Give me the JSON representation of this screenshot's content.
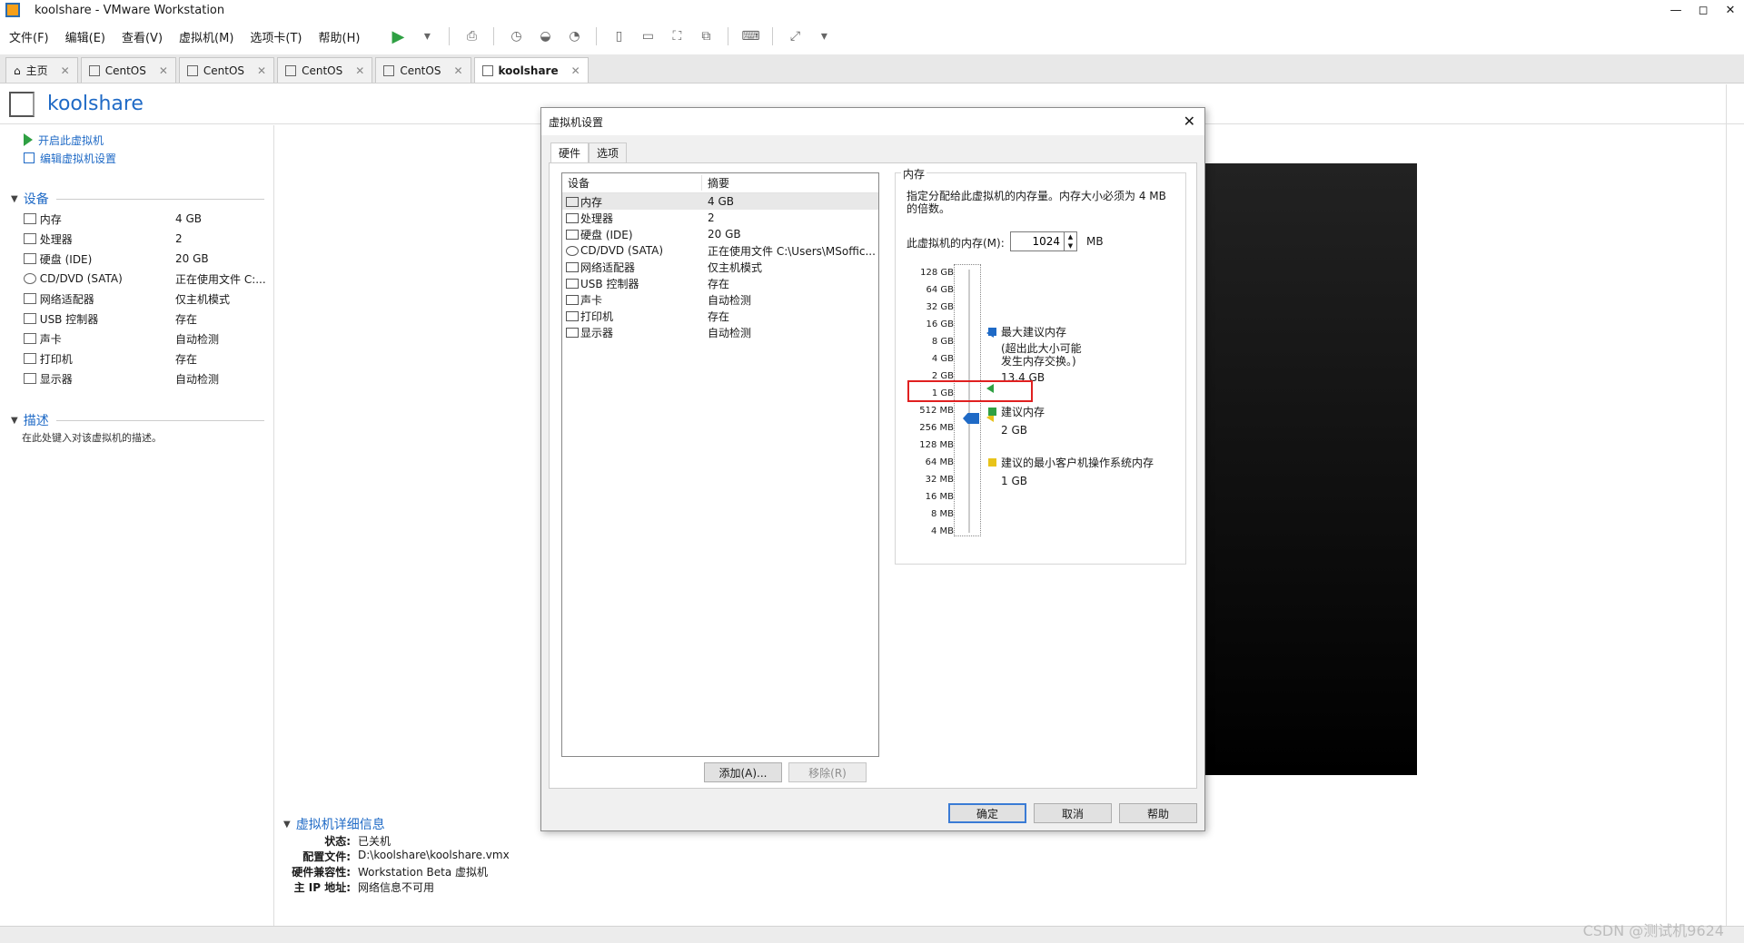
{
  "window": {
    "title": "koolshare - VMware Workstation",
    "controls": [
      "—",
      "◻",
      "✕"
    ]
  },
  "menu": {
    "items": [
      "文件(F)",
      "编辑(E)",
      "查看(V)",
      "虚拟机(M)",
      "选项卡(T)",
      "帮助(H)"
    ]
  },
  "tabs": [
    {
      "label": "主页"
    },
    {
      "label": "CentOS"
    },
    {
      "label": "CentOS"
    },
    {
      "label": "CentOS"
    },
    {
      "label": "CentOS"
    },
    {
      "label": "koolshare"
    }
  ],
  "vm": {
    "name": "koolshare",
    "actions": {
      "power_on": "开启此虚拟机",
      "edit_settings": "编辑虚拟机设置"
    },
    "devices_heading": "设备",
    "devices": [
      {
        "name": "内存",
        "value": "4 GB"
      },
      {
        "name": "处理器",
        "value": "2"
      },
      {
        "name": "硬盘 (IDE)",
        "value": "20 GB"
      },
      {
        "name": "CD/DVD (SATA)",
        "value": "正在使用文件 C:..."
      },
      {
        "name": "网络适配器",
        "value": "仅主机模式"
      },
      {
        "name": "USB 控制器",
        "value": "存在"
      },
      {
        "name": "声卡",
        "value": "自动检测"
      },
      {
        "name": "打印机",
        "value": "存在"
      },
      {
        "name": "显示器",
        "value": "自动检测"
      }
    ],
    "description_heading": "描述",
    "description_placeholder": "在此处键入对该虚拟机的描述。"
  },
  "details": {
    "heading": "虚拟机详细信息",
    "items": [
      {
        "key": "状态:",
        "value": "已关机"
      },
      {
        "key": "配置文件:",
        "value": "D:\\koolshare\\koolshare.vmx"
      },
      {
        "key": "硬件兼容性:",
        "value": "Workstation Beta 虚拟机"
      },
      {
        "key": "主 IP 地址:",
        "value": "网络信息不可用"
      }
    ]
  },
  "dialog": {
    "title": "虚拟机设置",
    "tabs": [
      "硬件",
      "选项"
    ],
    "list_headers": {
      "device": "设备",
      "summary": "摘要"
    },
    "devices": [
      {
        "name": "内存",
        "summary": "4 GB"
      },
      {
        "name": "处理器",
        "summary": "2"
      },
      {
        "name": "硬盘 (IDE)",
        "summary": "20 GB"
      },
      {
        "name": "CD/DVD (SATA)",
        "summary": "正在使用文件 C:\\Users\\MSoffic..."
      },
      {
        "name": "网络适配器",
        "summary": "仅主机模式"
      },
      {
        "name": "USB 控制器",
        "summary": "存在"
      },
      {
        "name": "声卡",
        "summary": "自动检测"
      },
      {
        "name": "打印机",
        "summary": "存在"
      },
      {
        "name": "显示器",
        "summary": "自动检测"
      }
    ],
    "buttons": {
      "add": "添加(A)...",
      "remove": "移除(R)",
      "ok": "确定",
      "cancel": "取消",
      "help": "帮助"
    },
    "memory": {
      "group_title": "内存",
      "description": "指定分配给此虚拟机的内存量。内存大小必须为 4 MB 的倍数。",
      "label": "此虚拟机的内存(M):",
      "value": "1024",
      "unit": "MB",
      "scale": [
        "128 GB",
        "64 GB",
        "32 GB",
        "16 GB",
        "8 GB",
        "4 GB",
        "2 GB",
        "1 GB",
        "512 MB",
        "256 MB",
        "128 MB",
        "64 MB",
        "32 MB",
        "16 MB",
        "8 MB",
        "4 MB"
      ],
      "max_recommended": {
        "label": "最大建议内存",
        "note1": "(超出此大小可能",
        "note2": "发生内存交换。)",
        "value": "13.4 GB"
      },
      "recommended": {
        "label": "建议内存",
        "value": "2 GB"
      },
      "min_recommended": {
        "label": "建议的最小客户机操作系统内存",
        "value": "1 GB"
      }
    }
  },
  "watermark": "CSDN @测试机9624",
  "colors": {
    "accent": "#1f6ac6",
    "green": "#2fa043",
    "yellow": "#e8c31a",
    "highlight": "#e02020"
  }
}
